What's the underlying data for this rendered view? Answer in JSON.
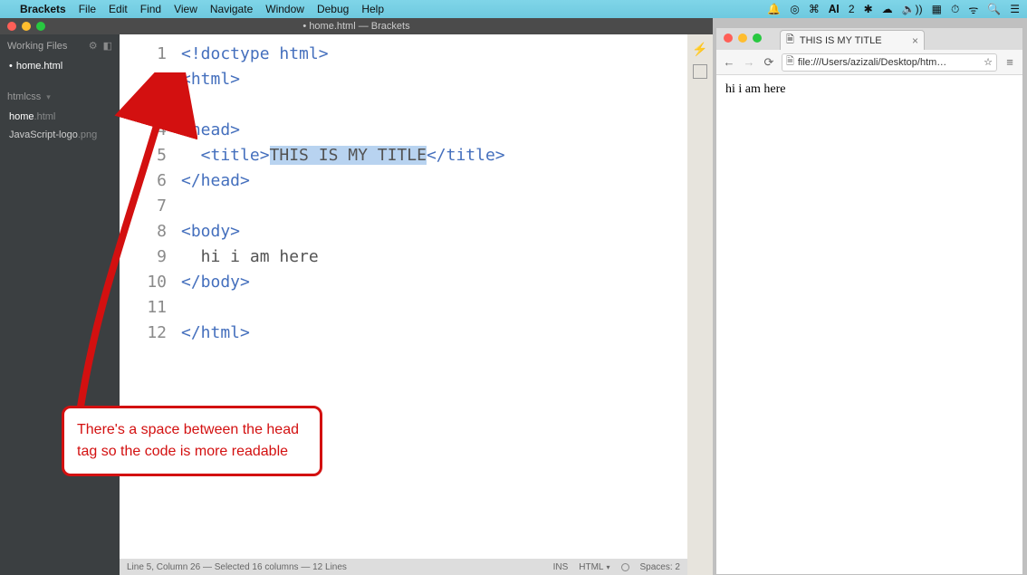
{
  "menubar": {
    "app": "Brackets",
    "items": [
      "File",
      "Edit",
      "Find",
      "View",
      "Navigate",
      "Window",
      "Debug",
      "Help"
    ],
    "right_glyphs": [
      "🔔",
      "◎",
      "⌘",
      "𝐀𝐈",
      "2",
      "✱",
      "☁︎",
      "🔈))",
      "▦",
      "⏱",
      "ᯤ",
      "🔍",
      "☰"
    ]
  },
  "brackets": {
    "title": "• home.html — Brackets",
    "sidebar": {
      "working_files_label": "Working Files",
      "working": [
        {
          "label": "home.html",
          "dirty": true
        }
      ],
      "project_label": "htmlcss",
      "files": [
        {
          "name": "home",
          "ext": ".html"
        },
        {
          "name": "JavaScript-logo",
          "ext": ".png"
        }
      ]
    },
    "code": {
      "lines": [
        "1",
        "2",
        "3",
        "4",
        "5",
        "6",
        "7",
        "8",
        "9",
        "10",
        "11",
        "12"
      ],
      "l1_a": "<!doctype html>",
      "l2_a": "<html>",
      "l3_a": "",
      "l4_a": "<head>",
      "l5_a": "  <title>",
      "l5_sel": "THIS IS MY TITLE",
      "l5_b": "</title>",
      "l6_a": "</head>",
      "l7_a": "",
      "l8_a": "<body>",
      "l9_a": "  hi i am here",
      "l10_a": "</body>",
      "l11_a": "",
      "l12_a": "</html>"
    },
    "status": {
      "left": "Line 5, Column 26 — Selected 16 columns — 12 Lines",
      "ins": "INS",
      "lang": "HTML",
      "spaces": "Spaces:  2"
    }
  },
  "chrome": {
    "tab_title": "THIS IS MY TITLE",
    "url": "file:///Users/azizali/Desktop/htm…",
    "page_text": "hi i am here"
  },
  "annotation": "There's a space between the head tag so the code is more readable"
}
